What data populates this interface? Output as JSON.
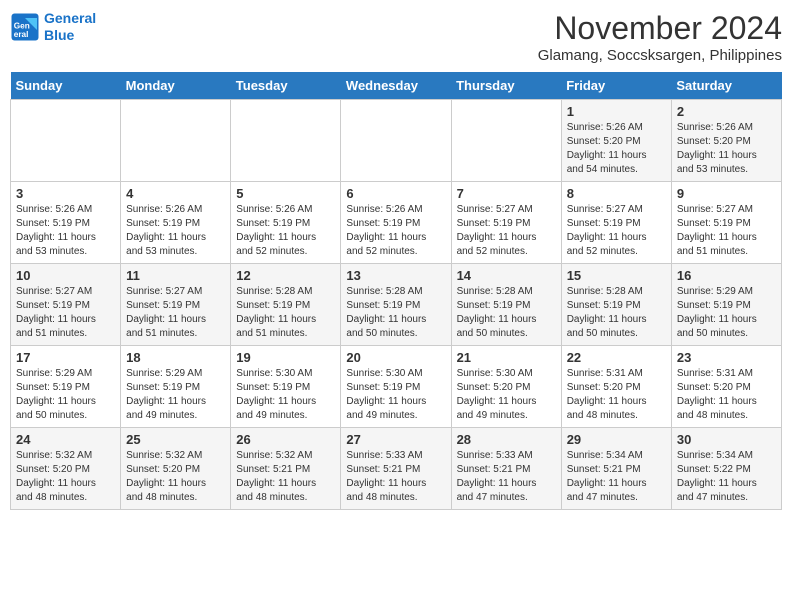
{
  "logo": {
    "line1": "General",
    "line2": "Blue"
  },
  "title": "November 2024",
  "subtitle": "Glamang, Soccsksargen, Philippines",
  "weekdays": [
    "Sunday",
    "Monday",
    "Tuesday",
    "Wednesday",
    "Thursday",
    "Friday",
    "Saturday"
  ],
  "weeks": [
    [
      {
        "day": "",
        "info": ""
      },
      {
        "day": "",
        "info": ""
      },
      {
        "day": "",
        "info": ""
      },
      {
        "day": "",
        "info": ""
      },
      {
        "day": "",
        "info": ""
      },
      {
        "day": "1",
        "info": "Sunrise: 5:26 AM\nSunset: 5:20 PM\nDaylight: 11 hours and 54 minutes."
      },
      {
        "day": "2",
        "info": "Sunrise: 5:26 AM\nSunset: 5:20 PM\nDaylight: 11 hours and 53 minutes."
      }
    ],
    [
      {
        "day": "3",
        "info": "Sunrise: 5:26 AM\nSunset: 5:19 PM\nDaylight: 11 hours and 53 minutes."
      },
      {
        "day": "4",
        "info": "Sunrise: 5:26 AM\nSunset: 5:19 PM\nDaylight: 11 hours and 53 minutes."
      },
      {
        "day": "5",
        "info": "Sunrise: 5:26 AM\nSunset: 5:19 PM\nDaylight: 11 hours and 52 minutes."
      },
      {
        "day": "6",
        "info": "Sunrise: 5:26 AM\nSunset: 5:19 PM\nDaylight: 11 hours and 52 minutes."
      },
      {
        "day": "7",
        "info": "Sunrise: 5:27 AM\nSunset: 5:19 PM\nDaylight: 11 hours and 52 minutes."
      },
      {
        "day": "8",
        "info": "Sunrise: 5:27 AM\nSunset: 5:19 PM\nDaylight: 11 hours and 52 minutes."
      },
      {
        "day": "9",
        "info": "Sunrise: 5:27 AM\nSunset: 5:19 PM\nDaylight: 11 hours and 51 minutes."
      }
    ],
    [
      {
        "day": "10",
        "info": "Sunrise: 5:27 AM\nSunset: 5:19 PM\nDaylight: 11 hours and 51 minutes."
      },
      {
        "day": "11",
        "info": "Sunrise: 5:27 AM\nSunset: 5:19 PM\nDaylight: 11 hours and 51 minutes."
      },
      {
        "day": "12",
        "info": "Sunrise: 5:28 AM\nSunset: 5:19 PM\nDaylight: 11 hours and 51 minutes."
      },
      {
        "day": "13",
        "info": "Sunrise: 5:28 AM\nSunset: 5:19 PM\nDaylight: 11 hours and 50 minutes."
      },
      {
        "day": "14",
        "info": "Sunrise: 5:28 AM\nSunset: 5:19 PM\nDaylight: 11 hours and 50 minutes."
      },
      {
        "day": "15",
        "info": "Sunrise: 5:28 AM\nSunset: 5:19 PM\nDaylight: 11 hours and 50 minutes."
      },
      {
        "day": "16",
        "info": "Sunrise: 5:29 AM\nSunset: 5:19 PM\nDaylight: 11 hours and 50 minutes."
      }
    ],
    [
      {
        "day": "17",
        "info": "Sunrise: 5:29 AM\nSunset: 5:19 PM\nDaylight: 11 hours and 50 minutes."
      },
      {
        "day": "18",
        "info": "Sunrise: 5:29 AM\nSunset: 5:19 PM\nDaylight: 11 hours and 49 minutes."
      },
      {
        "day": "19",
        "info": "Sunrise: 5:30 AM\nSunset: 5:19 PM\nDaylight: 11 hours and 49 minutes."
      },
      {
        "day": "20",
        "info": "Sunrise: 5:30 AM\nSunset: 5:19 PM\nDaylight: 11 hours and 49 minutes."
      },
      {
        "day": "21",
        "info": "Sunrise: 5:30 AM\nSunset: 5:20 PM\nDaylight: 11 hours and 49 minutes."
      },
      {
        "day": "22",
        "info": "Sunrise: 5:31 AM\nSunset: 5:20 PM\nDaylight: 11 hours and 48 minutes."
      },
      {
        "day": "23",
        "info": "Sunrise: 5:31 AM\nSunset: 5:20 PM\nDaylight: 11 hours and 48 minutes."
      }
    ],
    [
      {
        "day": "24",
        "info": "Sunrise: 5:32 AM\nSunset: 5:20 PM\nDaylight: 11 hours and 48 minutes."
      },
      {
        "day": "25",
        "info": "Sunrise: 5:32 AM\nSunset: 5:20 PM\nDaylight: 11 hours and 48 minutes."
      },
      {
        "day": "26",
        "info": "Sunrise: 5:32 AM\nSunset: 5:21 PM\nDaylight: 11 hours and 48 minutes."
      },
      {
        "day": "27",
        "info": "Sunrise: 5:33 AM\nSunset: 5:21 PM\nDaylight: 11 hours and 48 minutes."
      },
      {
        "day": "28",
        "info": "Sunrise: 5:33 AM\nSunset: 5:21 PM\nDaylight: 11 hours and 47 minutes."
      },
      {
        "day": "29",
        "info": "Sunrise: 5:34 AM\nSunset: 5:21 PM\nDaylight: 11 hours and 47 minutes."
      },
      {
        "day": "30",
        "info": "Sunrise: 5:34 AM\nSunset: 5:22 PM\nDaylight: 11 hours and 47 minutes."
      }
    ]
  ]
}
